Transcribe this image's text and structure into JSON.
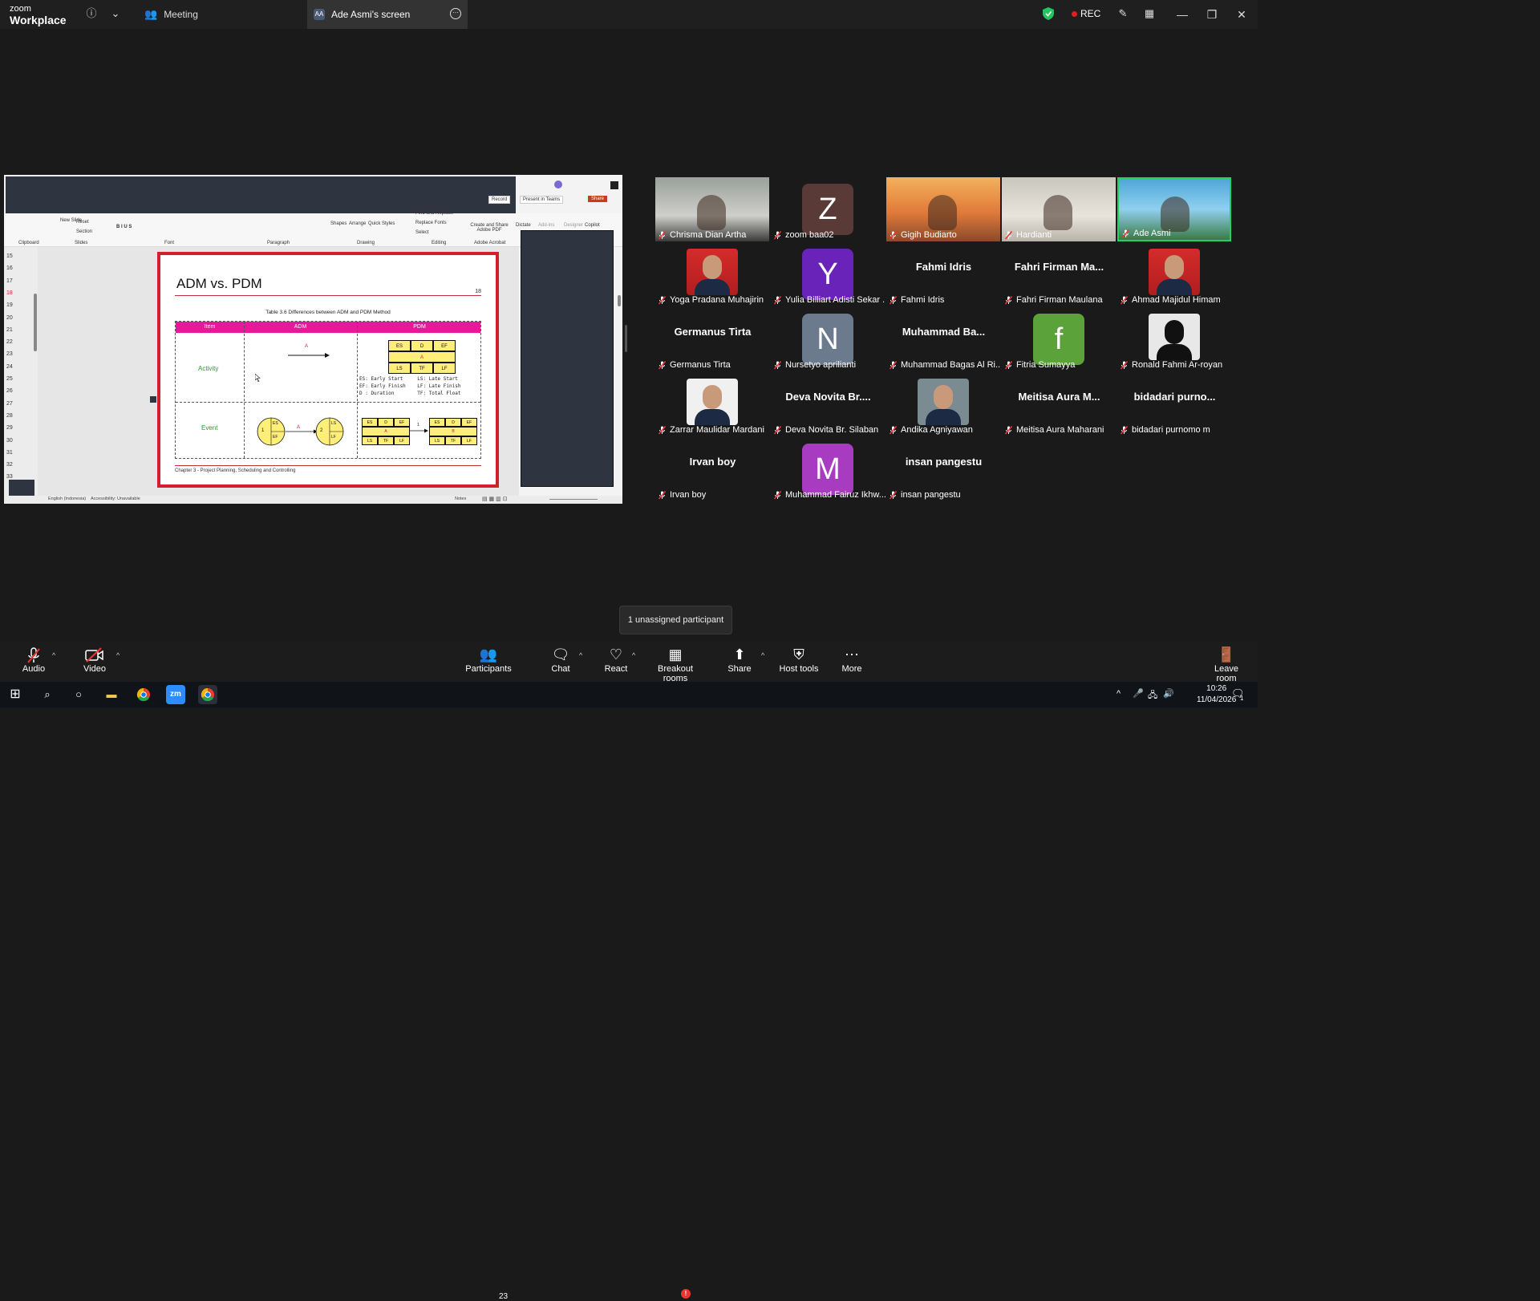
{
  "titlebar": {
    "brand_top": "zoom",
    "brand_bottom": "Workplace",
    "meeting_label": "Meeting",
    "screen_tab_initials": "AA",
    "screen_tab_label": "Ade Asmi's screen",
    "rec_label": "REC",
    "colors": {
      "shield": "#22c55e",
      "rec_dot": "#e02020"
    }
  },
  "shared_screen": {
    "ribbon": {
      "record": "Record",
      "present_in_teams": "Present in Teams",
      "share": "Share",
      "find_replace": "Find and Replace",
      "replace_fonts": "Replace Fonts",
      "select": "Select",
      "create_share_pdf": "Create and Share Adobe PDF",
      "dictate": "Dictate",
      "addins": "Add-ins",
      "designer": "Designer",
      "copilot": "Copilot",
      "new_slide": "New Slide",
      "reset": "Reset",
      "section": "Section",
      "shapes": "Shapes",
      "arrange": "Arrange",
      "quick_styles": "Quick Styles",
      "groups": [
        "Clipboard",
        "Slides",
        "Font",
        "Paragraph",
        "Drawing",
        "Editing",
        "Adobe Acrobat"
      ]
    },
    "slide_numbers": [
      "15",
      "16",
      "17",
      "18",
      "19",
      "20",
      "21",
      "22",
      "23",
      "24",
      "25",
      "26",
      "27",
      "28",
      "29",
      "30",
      "31",
      "32",
      "33"
    ],
    "slide": {
      "title": "ADM vs. PDM",
      "page_number": "18",
      "table_caption": "Table 3.6  Differences between ADM and PDM Method",
      "headers": [
        "Item",
        "ADM",
        "PDM"
      ],
      "row1_label": "Activity",
      "row2_label": "Event",
      "arrow_label": "A",
      "pdm_box": [
        "ES",
        "D",
        "EF",
        "A",
        "LS",
        "TF",
        "LF"
      ],
      "legend_line1": "ES: Early Start     LS: Late Start",
      "legend_line2": "EF: Early Finish    LF: Late Finish",
      "legend_line3": "D : Duration        TF: Total Float",
      "event_node1": "1",
      "event_node2": "2",
      "event_es": "ES",
      "event_ef": "EF",
      "event_ls": "LS",
      "event_lf": "LF",
      "event_box_left": [
        "ES",
        "D",
        "EF",
        "A",
        "LS",
        "TF",
        "LF"
      ],
      "event_box_right": [
        "ES",
        "D",
        "EF",
        "B",
        "LS",
        "TF",
        "LF"
      ],
      "event_arrow_label": "1",
      "chapter": "Chapter 3 - Project Planning, Scheduling and Controlling",
      "colors": {
        "border": "#d0202a",
        "header": "#e6199a",
        "row_label": "#2a9d2a",
        "node_fill": "#ffee77"
      }
    },
    "statusbar": {
      "language": "English (Indonesia)",
      "accessibility": "Accessibility: Unavailable",
      "notes": "Notes"
    }
  },
  "participants": [
    {
      "name": "Chrisma Dian Artha",
      "kind": "video"
    },
    {
      "name": "zoom baa02",
      "kind": "letter",
      "letter": "Z",
      "color": "#5a3a36"
    },
    {
      "name": "Gigih Budiarto",
      "kind": "video"
    },
    {
      "name": "Hardianti",
      "kind": "video"
    },
    {
      "name": "Ade Asmi",
      "kind": "video",
      "active": true
    },
    {
      "name": "Yoga Pradana Muhajirin",
      "kind": "photo"
    },
    {
      "name": "Yulia Billiart Adisti Sekar ...",
      "kind": "letter",
      "letter": "Y",
      "color": "#6a23b8"
    },
    {
      "name": "Fahmi Idris",
      "kind": "text",
      "display": "Fahmi Idris"
    },
    {
      "name": "Fahri Firman Maulana",
      "kind": "text",
      "display": "Fahri Firman Ma..."
    },
    {
      "name": "Ahmad Majidul Himam",
      "kind": "photo"
    },
    {
      "name": "Germanus Tirta",
      "kind": "text",
      "display": "Germanus Tirta"
    },
    {
      "name": "Nursetyo aprilianti",
      "kind": "letter",
      "letter": "N",
      "color": "#6b7a8c"
    },
    {
      "name": "Muhammad Bagas Al Ri...",
      "kind": "text",
      "display": "Muhammad Ba..."
    },
    {
      "name": "Fitria Sumayya",
      "kind": "letter",
      "letter": "f",
      "color": "#5ba23a"
    },
    {
      "name": "Ronald Fahmi Ar-royan",
      "kind": "photo"
    },
    {
      "name": "Zarrar Maulidar Mardani",
      "kind": "photo"
    },
    {
      "name": "Deva Novita Br. Silaban",
      "kind": "text",
      "display": "Deva Novita Br...."
    },
    {
      "name": "Andika Agniyawan",
      "kind": "photo"
    },
    {
      "name": "Meitisa Aura Maharani",
      "kind": "text",
      "display": "Meitisa Aura M..."
    },
    {
      "name": "bidadari purnomo m",
      "kind": "text",
      "display": "bidadari purno..."
    },
    {
      "name": "Irvan boy",
      "kind": "text",
      "display": "Irvan boy"
    },
    {
      "name": "Muhammad Fairuz Ikhw...",
      "kind": "letter",
      "letter": "M",
      "color": "#a83cc0"
    },
    {
      "name": "insan pangestu",
      "kind": "text",
      "display": "insan pangestu"
    }
  ],
  "tooltip": "1 unassigned participant",
  "toolbar": {
    "audio": "Audio",
    "video": "Video",
    "participants": "Participants",
    "participants_count": "23",
    "chat": "Chat",
    "react": "React",
    "breakout": "Breakout rooms",
    "breakout_badge": "!",
    "share": "Share",
    "host_tools": "Host tools",
    "more": "More",
    "leave": "Leave room"
  },
  "taskbar": {
    "time": "10:26",
    "date": "11/04/2026",
    "notif_count": "1"
  }
}
